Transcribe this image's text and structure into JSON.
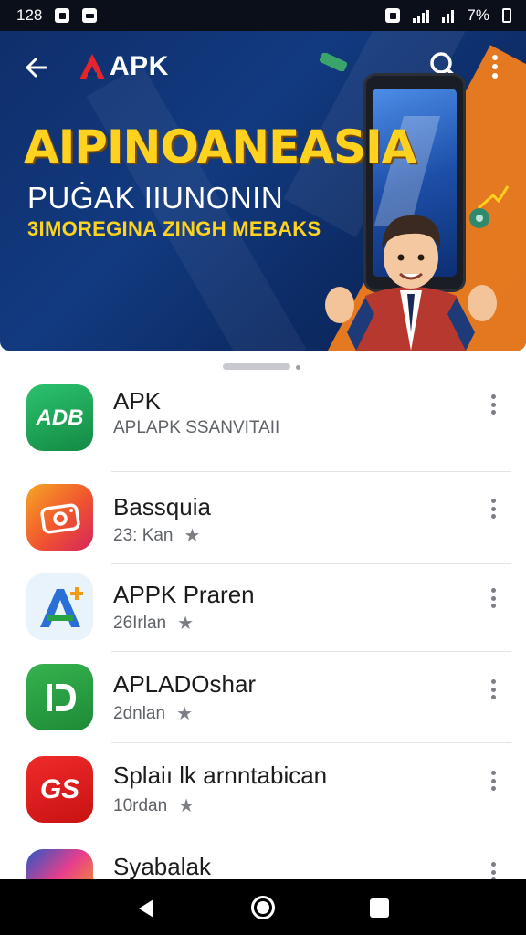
{
  "status_bar": {
    "time": "128",
    "battery_text": "7%"
  },
  "header": {
    "brand": "APK",
    "hero_title": "AIPINOANEASIA",
    "hero_subtitle": "PUĠAK IIUNONIN",
    "hero_tagline": "3IMOREGINA ZINGH MEBAKS"
  },
  "apps": [
    {
      "name": "APK",
      "meta": "APLAPK SSANVITAII",
      "icon_label": "ADB",
      "icon": "adb-app-icon",
      "color": "#1ea45a"
    },
    {
      "name": "Bassquia",
      "meta": "23: Kan",
      "icon": "camera-app-icon",
      "color": "#f05a5a"
    },
    {
      "name": "APPK Praren",
      "meta": "26Irlan",
      "icon": "a-plus-app-icon",
      "color": "#e6f2fb"
    },
    {
      "name": "APLADOshar",
      "meta": "2dnlan",
      "icon": "d-app-icon",
      "color": "#27a243"
    },
    {
      "name": "Splaiı lk arnntabican",
      "meta": "10rdan",
      "icon_label": "GS",
      "icon": "gs-app-icon",
      "color": "#e21b1b"
    },
    {
      "name": "Syabalak",
      "meta": "",
      "icon": "colorful-app-icon",
      "color": "#2a58c4"
    }
  ],
  "colors": {
    "hero_bg": "#123a80",
    "accent_orange": "#f07d1e",
    "accent_yellow": "#ffd21f"
  }
}
